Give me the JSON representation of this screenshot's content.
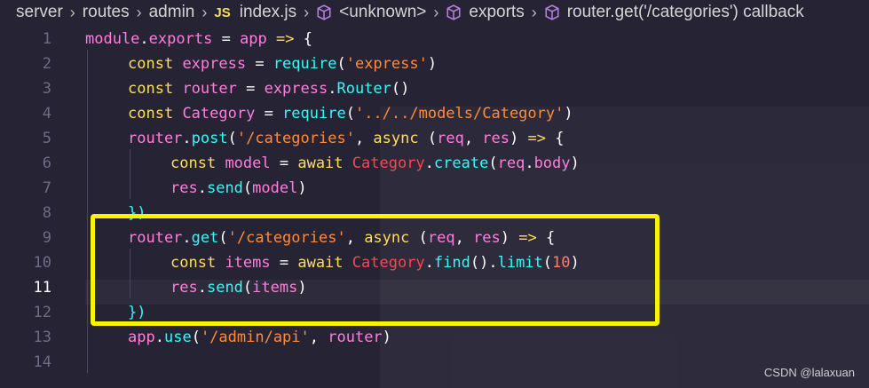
{
  "breadcrumb": {
    "segments": [
      "server",
      "routes",
      "admin",
      "index.js",
      "<unknown>",
      "exports",
      "router.get('/categories') callback"
    ],
    "file_badge": "JS"
  },
  "editor": {
    "active_line": 11,
    "lines": [
      {
        "num": "1",
        "tokens": [
          [
            "var",
            "module"
          ],
          [
            "pn",
            "."
          ],
          [
            "var",
            "exports"
          ],
          [
            "pn",
            " = "
          ],
          [
            "var",
            "app"
          ],
          [
            "pn",
            " "
          ],
          [
            "kw",
            "=>"
          ],
          [
            "pn",
            " {"
          ]
        ]
      },
      {
        "num": "2",
        "tokens": [
          [
            "kw",
            "const"
          ],
          [
            "pn",
            " "
          ],
          [
            "var",
            "express"
          ],
          [
            "pn",
            " = "
          ],
          [
            "fn",
            "require"
          ],
          [
            "pn",
            "("
          ],
          [
            "str",
            "'express'"
          ],
          [
            "pn",
            ")"
          ]
        ]
      },
      {
        "num": "3",
        "tokens": [
          [
            "kw",
            "const"
          ],
          [
            "pn",
            " "
          ],
          [
            "var",
            "router"
          ],
          [
            "pn",
            " = "
          ],
          [
            "var",
            "express"
          ],
          [
            "pn",
            "."
          ],
          [
            "fn",
            "Router"
          ],
          [
            "pn",
            "()"
          ]
        ]
      },
      {
        "num": "4",
        "tokens": [
          [
            "kw",
            "const"
          ],
          [
            "pn",
            " "
          ],
          [
            "var",
            "Category"
          ],
          [
            "pn",
            " = "
          ],
          [
            "fn",
            "require"
          ],
          [
            "pn",
            "("
          ],
          [
            "str",
            "'../../models/Category'"
          ],
          [
            "pn",
            ")"
          ]
        ]
      },
      {
        "num": "5",
        "tokens": [
          [
            "var",
            "router"
          ],
          [
            "pn",
            "."
          ],
          [
            "fn",
            "post"
          ],
          [
            "pn",
            "("
          ],
          [
            "str",
            "'/categories'"
          ],
          [
            "pn",
            ", "
          ],
          [
            "kw",
            "async"
          ],
          [
            "pn",
            " ("
          ],
          [
            "var",
            "req"
          ],
          [
            "pn",
            ", "
          ],
          [
            "var",
            "res"
          ],
          [
            "pn",
            ") "
          ],
          [
            "kw",
            "=>"
          ],
          [
            "pn",
            " {"
          ]
        ]
      },
      {
        "num": "6",
        "tokens": [
          [
            "kw",
            "const"
          ],
          [
            "pn",
            " "
          ],
          [
            "var",
            "model"
          ],
          [
            "pn",
            " = "
          ],
          [
            "kw",
            "await"
          ],
          [
            "pn",
            " "
          ],
          [
            "cls",
            "Category"
          ],
          [
            "pn",
            "."
          ],
          [
            "fn",
            "create"
          ],
          [
            "pn",
            "("
          ],
          [
            "var",
            "req"
          ],
          [
            "pn",
            "."
          ],
          [
            "var",
            "body"
          ],
          [
            "pn",
            ")"
          ]
        ]
      },
      {
        "num": "7",
        "tokens": [
          [
            "var",
            "res"
          ],
          [
            "pn",
            "."
          ],
          [
            "fn",
            "send"
          ],
          [
            "pn",
            "("
          ],
          [
            "var",
            "model"
          ],
          [
            "pn",
            ")"
          ]
        ]
      },
      {
        "num": "8",
        "tokens": [
          [
            "bkt",
            "})"
          ]
        ]
      },
      {
        "num": "9",
        "tokens": [
          [
            "var",
            "router"
          ],
          [
            "pn",
            "."
          ],
          [
            "fn",
            "get"
          ],
          [
            "pn",
            "("
          ],
          [
            "str",
            "'/categories'"
          ],
          [
            "pn",
            ", "
          ],
          [
            "kw",
            "async"
          ],
          [
            "pn",
            " ("
          ],
          [
            "var",
            "req"
          ],
          [
            "pn",
            ", "
          ],
          [
            "var",
            "res"
          ],
          [
            "pn",
            ") "
          ],
          [
            "kw",
            "=>"
          ],
          [
            "pn",
            " {"
          ]
        ]
      },
      {
        "num": "10",
        "tokens": [
          [
            "kw",
            "const"
          ],
          [
            "pn",
            " "
          ],
          [
            "var",
            "items"
          ],
          [
            "pn",
            " = "
          ],
          [
            "kw",
            "await"
          ],
          [
            "pn",
            " "
          ],
          [
            "cls",
            "Category"
          ],
          [
            "pn",
            "."
          ],
          [
            "fn",
            "find"
          ],
          [
            "pn",
            "()."
          ],
          [
            "fn",
            "limit"
          ],
          [
            "pn",
            "("
          ],
          [
            "num",
            "10"
          ],
          [
            "pn",
            ")"
          ]
        ]
      },
      {
        "num": "11",
        "tokens": [
          [
            "var",
            "res"
          ],
          [
            "pn",
            "."
          ],
          [
            "fn",
            "send"
          ],
          [
            "pn",
            "("
          ],
          [
            "var",
            "items"
          ],
          [
            "pn",
            ")"
          ]
        ]
      },
      {
        "num": "12",
        "tokens": [
          [
            "bkt",
            "})"
          ]
        ]
      },
      {
        "num": "13",
        "tokens": [
          [
            "var",
            "app"
          ],
          [
            "pn",
            "."
          ],
          [
            "fn",
            "use"
          ],
          [
            "pn",
            "("
          ],
          [
            "str",
            "'/admin/api'"
          ],
          [
            "pn",
            ", "
          ],
          [
            "var",
            "router"
          ],
          [
            "pn",
            ")"
          ]
        ]
      },
      {
        "num": "14",
        "tokens": []
      }
    ]
  },
  "watermark": "CSDN @lalaxuan",
  "colors": {
    "background": "#262335",
    "highlight_box": "#fff200",
    "keyword": "#fede5d",
    "variable": "#ff7edb",
    "function": "#36f9f6",
    "string": "#ff8b39",
    "class": "#fe4450",
    "number": "#f97e72"
  },
  "icons": [
    "chevron-right-icon",
    "symbol-cube-icon"
  ]
}
